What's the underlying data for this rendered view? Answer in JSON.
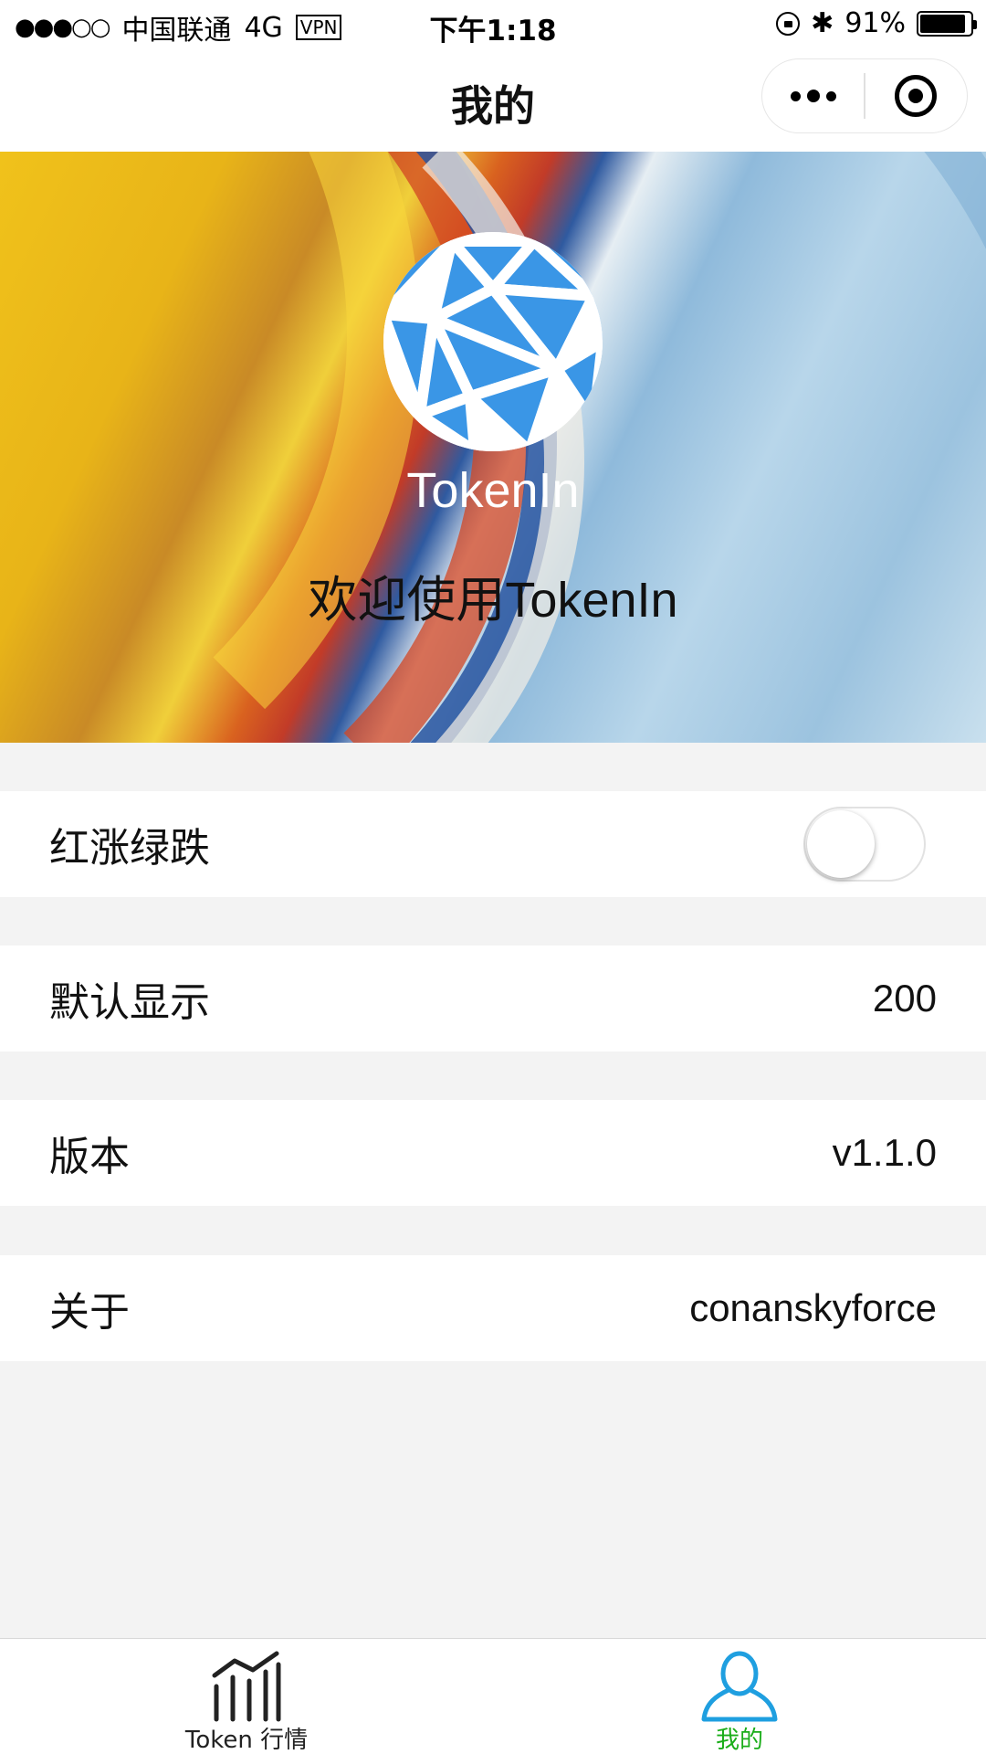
{
  "status_bar": {
    "signal": "●●●○○",
    "carrier": "中国联通",
    "network": "4G",
    "vpn": "VPN",
    "time": "下午1:18",
    "bluetooth": "✱",
    "battery_pct": "91%",
    "battery_level": 0.91
  },
  "nav": {
    "title": "我的",
    "capsule_icons": [
      "more-dots-icon",
      "close-target-icon"
    ]
  },
  "banner": {
    "brand": "TokenIn",
    "welcome": "欢迎使用TokenIn",
    "logo_color": "#3a96e6"
  },
  "settings": [
    {
      "label": "红涨绿跌",
      "type": "switch",
      "on": false
    },
    {
      "label": "默认显示",
      "value": "200"
    },
    {
      "label": "版本",
      "value": "v1.1.0"
    },
    {
      "label": "关于",
      "value": "conanskyforce"
    }
  ],
  "tabs": [
    {
      "label": "Token 行情",
      "icon": "chart-icon",
      "active": false
    },
    {
      "label": "我的",
      "icon": "user-icon",
      "active": true
    }
  ],
  "colors": {
    "tab_active_label": "#1aad19",
    "tab_active_icon": "#1f9fe0",
    "background": "#f3f3f3"
  }
}
